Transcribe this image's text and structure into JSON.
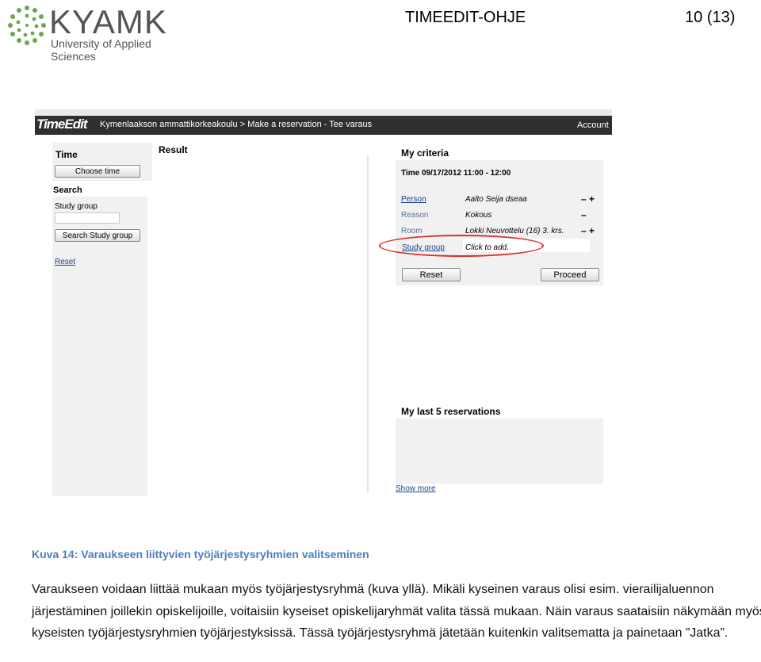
{
  "header": {
    "logo_text": "KYAMK",
    "logo_subtitle": "University of Applied Sciences",
    "doc_title": "TIMEEDIT-OHJE",
    "page_number": "10 (13)"
  },
  "screenshot": {
    "brand": "TimeEdit",
    "breadcrumb": "Kymenlaakson ammattikorkeakoulu > Make a reservation - Tee varaus",
    "account": "Account",
    "left_panel": {
      "time_label": "Time",
      "choose_time_button": "Choose time",
      "search_label": "Search",
      "study_group_label": "Study group",
      "study_group_input_value": "",
      "search_study_group_button": "Search Study group",
      "reset_link": "Reset"
    },
    "result_label": "Result",
    "criteria": {
      "title": "My criteria",
      "time_line": "Time 09/17/2012 11:00 - 12:00",
      "rows": [
        {
          "label": "Person",
          "value": "Aalto Seija dseaa",
          "controls": "–   +"
        },
        {
          "label": "Reason",
          "value": "Kokous",
          "controls": "–"
        },
        {
          "label": "Room",
          "value": "Lokki Neuvottelu (16) 3. krs.",
          "controls": "–   +"
        },
        {
          "label": "Study group",
          "value": "Click to add.",
          "controls": ""
        }
      ],
      "reset_button": "Reset",
      "proceed_button": "Proceed"
    },
    "last_reservations_title": "My last 5 reservations",
    "show_more_link": "Show more",
    "highlight_color": "#d9302b"
  },
  "caption": "Kuva 14: Varaukseen liittyvien työjärjestysryhmien valitseminen",
  "body_text": "Varaukseen voidaan liittää mukaan myös työjärjestysryhmä (kuva yllä). Mikäli kyseinen varaus olisi esim. vierailijaluennon järjestäminen joillekin opiskelijoille, voitaisiin kyseiset opiskelijaryhmät valita tässä mukaan. Näin varaus saataisiin näkymään myös kyseisten työjärjestysryhmien työjärjestyksissä. Tässä työjärjestysryhmä jätetään kuitenkin valitsematta ja painetaan ”Jatka”."
}
